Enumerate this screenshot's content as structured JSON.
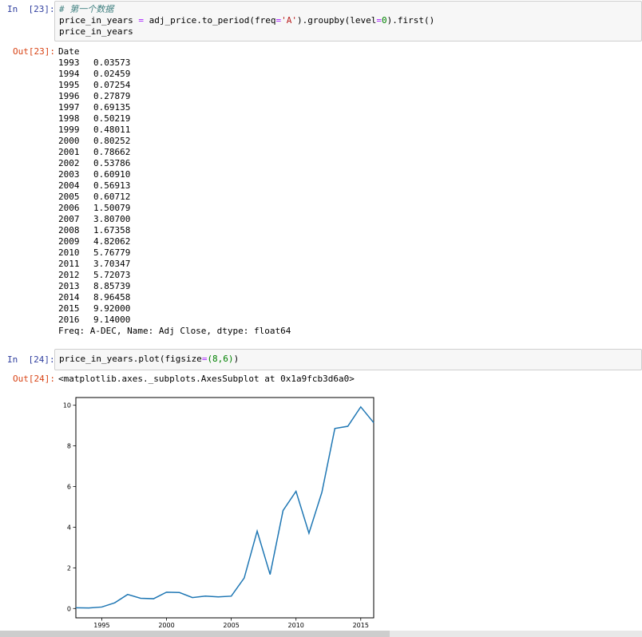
{
  "cells": {
    "in23": {
      "prompt": "In  [23]:",
      "line1": {
        "comment": "# 第一个数据"
      },
      "line2": {
        "var": "price_in_years",
        "op": "=",
        "pre": "adj_price.to_period(freq",
        "eq": "=",
        "str": "'A'",
        "post": ").groupby(level",
        "eq2": "=",
        "num": "0",
        "tail": ").first()"
      },
      "line3": "price_in_years"
    },
    "out23": {
      "prompt": "Out[23]:",
      "header": "Date",
      "rows": [
        {
          "year": "1993",
          "value": "0.03573"
        },
        {
          "year": "1994",
          "value": "0.02459"
        },
        {
          "year": "1995",
          "value": "0.07254"
        },
        {
          "year": "1996",
          "value": "0.27879"
        },
        {
          "year": "1997",
          "value": "0.69135"
        },
        {
          "year": "1998",
          "value": "0.50219"
        },
        {
          "year": "1999",
          "value": "0.48011"
        },
        {
          "year": "2000",
          "value": "0.80252"
        },
        {
          "year": "2001",
          "value": "0.78662"
        },
        {
          "year": "2002",
          "value": "0.53786"
        },
        {
          "year": "2003",
          "value": "0.60910"
        },
        {
          "year": "2004",
          "value": "0.56913"
        },
        {
          "year": "2005",
          "value": "0.60712"
        },
        {
          "year": "2006",
          "value": "1.50079"
        },
        {
          "year": "2007",
          "value": "3.80700"
        },
        {
          "year": "2008",
          "value": "1.67358"
        },
        {
          "year": "2009",
          "value": "4.82062"
        },
        {
          "year": "2010",
          "value": "5.76779"
        },
        {
          "year": "2011",
          "value": "3.70347"
        },
        {
          "year": "2012",
          "value": "5.72073"
        },
        {
          "year": "2013",
          "value": "8.85739"
        },
        {
          "year": "2014",
          "value": "8.96458"
        },
        {
          "year": "2015",
          "value": "9.92000"
        },
        {
          "year": "2016",
          "value": "9.14000"
        }
      ],
      "footer": "Freq: A-DEC, Name: Adj Close, dtype: float64"
    },
    "in24": {
      "prompt": "In  [24]:",
      "pre": "price_in_years.plot(figsize",
      "eq": "=",
      "num": "(8,6)",
      "post": ")"
    },
    "out24": {
      "prompt": "Out[24]:",
      "repr": "<matplotlib.axes._subplots.AxesSubplot at 0x1a9fcb3d6a0>"
    }
  },
  "chart_data": {
    "type": "line",
    "title": "",
    "xlabel": "",
    "ylabel": "",
    "x": [
      1993,
      1994,
      1995,
      1996,
      1997,
      1998,
      1999,
      2000,
      2001,
      2002,
      2003,
      2004,
      2005,
      2006,
      2007,
      2008,
      2009,
      2010,
      2011,
      2012,
      2013,
      2014,
      2015,
      2016
    ],
    "series": [
      {
        "values": [
          0.03573,
          0.02459,
          0.07254,
          0.27879,
          0.69135,
          0.50219,
          0.48011,
          0.80252,
          0.78662,
          0.53786,
          0.6091,
          0.56913,
          0.60712,
          1.50079,
          3.807,
          1.67358,
          4.82062,
          5.76779,
          3.70347,
          5.72073,
          8.85739,
          8.96458,
          9.92,
          9.14
        ],
        "color": "#1f77b4"
      }
    ],
    "xlim": [
      1993,
      2016
    ],
    "ylim": [
      -0.46,
      10.38
    ],
    "xticks": [
      "1995",
      "2000",
      "2005",
      "2010",
      "2015"
    ],
    "yticks": [
      "0",
      "2",
      "4",
      "6",
      "8",
      "10"
    ],
    "grid": false
  }
}
